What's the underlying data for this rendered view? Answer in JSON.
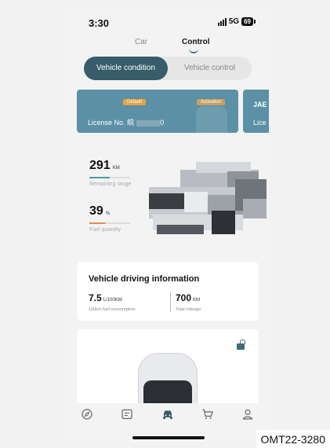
{
  "status_bar": {
    "time": "3:30",
    "network": "5G",
    "battery": "69"
  },
  "top_tabs": [
    {
      "label": "Car",
      "active": false
    },
    {
      "label": "Control",
      "active": true
    }
  ],
  "segment": {
    "selected": "Vehicle condition",
    "other": "Vehicle control"
  },
  "vehicle_cards": [
    {
      "default_badge": "Default",
      "activation_badge": "Activation",
      "license_label": "License No.",
      "license_prefix": "皖",
      "license_suffix": "0"
    },
    {
      "title": "JAE",
      "license_label": "Lice"
    }
  ],
  "range": {
    "value": "291",
    "unit": "KM",
    "label": "Remaining range",
    "level": 0.5
  },
  "fuel": {
    "value": "39",
    "unit": "%",
    "label": "Fuel quantity",
    "level": 0.39
  },
  "driving_info": {
    "title": "Vehicle driving information",
    "consumption": {
      "value": "7.5",
      "unit": "L/100KM",
      "label": "100km fuel consumption"
    },
    "mileage": {
      "value": "700",
      "unit": "KM",
      "label": "Total mileage"
    }
  },
  "bottom_nav": [
    "compass-icon",
    "message-icon",
    "car-icon",
    "cart-icon",
    "user-icon"
  ],
  "caption": "OMT22-3280",
  "colors": {
    "accent": "#375c6a",
    "card": "#5b90a6",
    "range_bar": "#4e9aa8",
    "fuel_bar": "#e58a4c"
  }
}
